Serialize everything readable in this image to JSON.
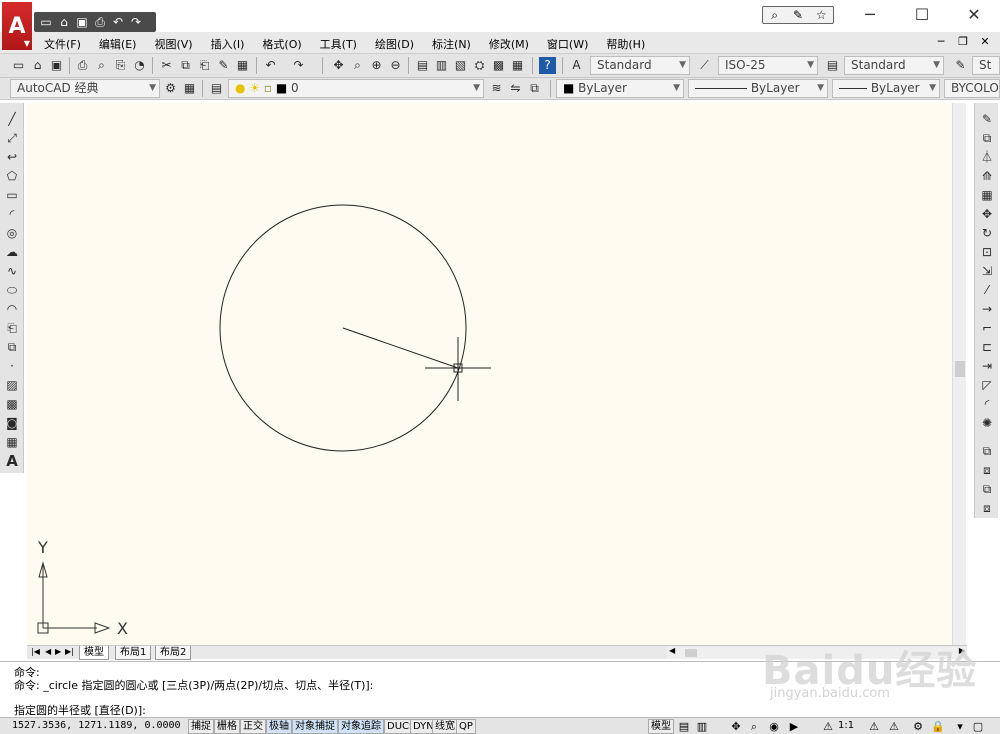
{
  "app": {
    "logo": "A"
  },
  "quick_access": [
    "new-icon",
    "open-icon",
    "save-icon",
    "print-icon",
    "undo-icon",
    "redo-icon"
  ],
  "menu": {
    "items": [
      "文件(F)",
      "编辑(E)",
      "视图(V)",
      "插入(I)",
      "格式(O)",
      "工具(T)",
      "绘图(D)",
      "标注(N)",
      "修改(M)",
      "窗口(W)",
      "帮助(H)"
    ]
  },
  "toolbar1": {
    "text_style": "Standard",
    "dim_style": "ISO-25",
    "table_style": "Standard",
    "multileader_style": "St"
  },
  "toolbar2": {
    "workspace": "AutoCAD 经典",
    "layer": "0",
    "color": "ByLayer",
    "linetype": "ByLayer",
    "lineweight": "ByLayer",
    "plotstyle": "BYCOLOR"
  },
  "ucs": {
    "x_label": "X",
    "y_label": "Y"
  },
  "layout_tabs": [
    "模型",
    "布局1",
    "布局2"
  ],
  "command": {
    "line1": "命令:",
    "line2": "命令: _circle 指定圆的圆心或 [三点(3P)/两点(2P)/切点、切点、半径(T)]:",
    "line3": "指定圆的半径或 [直径(D)]:"
  },
  "status": {
    "coords": "1527.3536,  1271.1189,  0.0000",
    "buttons": [
      "捕捉",
      "栅格",
      "正交",
      "极轴",
      "对象捕捉",
      "对象追踪",
      "DUCS",
      "DYN",
      "线宽",
      "QP"
    ],
    "on_buttons": [
      "极轴",
      "对象捕捉",
      "对象追踪"
    ],
    "model_label": "模型",
    "annotation_scale": "1:1"
  },
  "watermark": {
    "brand": "Baidu经验",
    "url": "jingyan.baidu.com"
  }
}
